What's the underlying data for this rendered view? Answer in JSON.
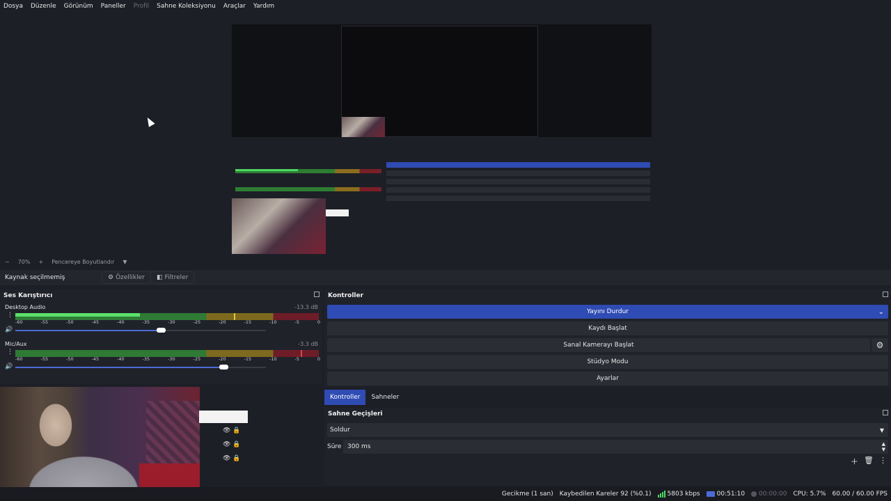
{
  "menubar": {
    "items": [
      "Dosya",
      "Düzenle",
      "Görünüm",
      "Paneller",
      "Profil",
      "Sahne Koleksiyonu",
      "Araçlar",
      "Yardım"
    ]
  },
  "zoombar": {
    "minus": "−",
    "zoom": "70%",
    "plus": "+",
    "fit_label": "Pencereye Boyutlandır",
    "dropdown": "▼"
  },
  "sourcebar": {
    "no_source": "Kaynak seçilmemiş",
    "properties": "Özellikler",
    "filters": "Filtreler"
  },
  "mixer": {
    "title": "Ses Karıştırıcı",
    "ticks": [
      "-60",
      "-55",
      "-50",
      "-45",
      "-40",
      "-35",
      "-30",
      "-25",
      "-20",
      "-15",
      "-10",
      "-5",
      "0"
    ],
    "tracks": [
      {
        "name": "Desktop Audio",
        "db": "-13.3 dB",
        "level": 0.41,
        "peak": 0.72,
        "volume": 0.58
      },
      {
        "name": "Mic/Aux",
        "db": "-3.3 dB",
        "level": 0.0,
        "peak": 0.94,
        "volume": 0.83
      }
    ]
  },
  "controls": {
    "title": "Kontroller",
    "stop_stream": "Yayını Durdur",
    "start_record": "Kaydı Başlat",
    "start_virtualcam": "Sanal Kamerayı Başlat",
    "studio_mode": "Stüdyo Modu",
    "settings": "Ayarlar"
  },
  "tabs": {
    "controls": "Kontroller",
    "scenes": "Sahneler"
  },
  "transitions": {
    "title": "Sahne Geçişleri",
    "selected": "Soldur",
    "duration_label": "Süre",
    "duration_value": "300 ms"
  },
  "status": {
    "delay": "Gecikme (1 san)",
    "dropped": "Kaybedilen Kareler 92 (%0.1)",
    "bitrate": "5803 kbps",
    "stream_time": "00:51:10",
    "record_time": "00:00:00",
    "cpu": "CPU: 5.7%",
    "fps": "60.00 / 60.00 FPS"
  },
  "colors": {
    "accent": "#2f4bb4",
    "bg": "#1d1f26",
    "meter_green": "#2f7a35",
    "meter_yellow": "#7d6a1e",
    "meter_red": "#6e1d28"
  }
}
